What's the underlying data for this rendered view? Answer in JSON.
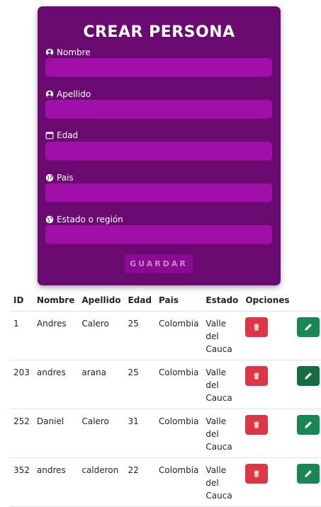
{
  "form": {
    "title": "CREAR PERSONA",
    "fields": [
      {
        "label": "Nombre",
        "icon": "user-circle-icon",
        "value": ""
      },
      {
        "label": "Apellido",
        "icon": "user-circle-icon",
        "value": ""
      },
      {
        "label": "Edad",
        "icon": "calendar-icon",
        "value": ""
      },
      {
        "label": "Pais",
        "icon": "globe-icon",
        "value": ""
      },
      {
        "label": "Estado o región",
        "icon": "globe-americas-icon",
        "value": ""
      }
    ],
    "save_label": "GUARDAR"
  },
  "table": {
    "headers": [
      "ID",
      "Nombre",
      "Apellido",
      "Edad",
      "Pais",
      "Estado",
      "Opciones"
    ],
    "rows": [
      {
        "id": "1",
        "nombre": "Andres",
        "apellido": "Calero",
        "edad": "25",
        "pais": "Colombia",
        "estado": "Valle del Cauca"
      },
      {
        "id": "203",
        "nombre": "andres",
        "apellido": "arana",
        "edad": "25",
        "pais": "Colombia",
        "estado": "Valle del Cauca"
      },
      {
        "id": "252",
        "nombre": "Daniel",
        "apellido": "Calero",
        "edad": "31",
        "pais": "Colombia",
        "estado": "Valle del Cauca"
      },
      {
        "id": "352",
        "nombre": "andres",
        "apellido": "calderon",
        "edad": "22",
        "pais": "Colombia",
        "estado": "Valle del Cauca"
      }
    ],
    "delete_icon": "trash-icon",
    "edit_icon": "pencil-icon"
  },
  "colors": {
    "card": "#6a0a70",
    "input": "#a010a8",
    "delete": "#dc3545",
    "edit": "#198754"
  }
}
